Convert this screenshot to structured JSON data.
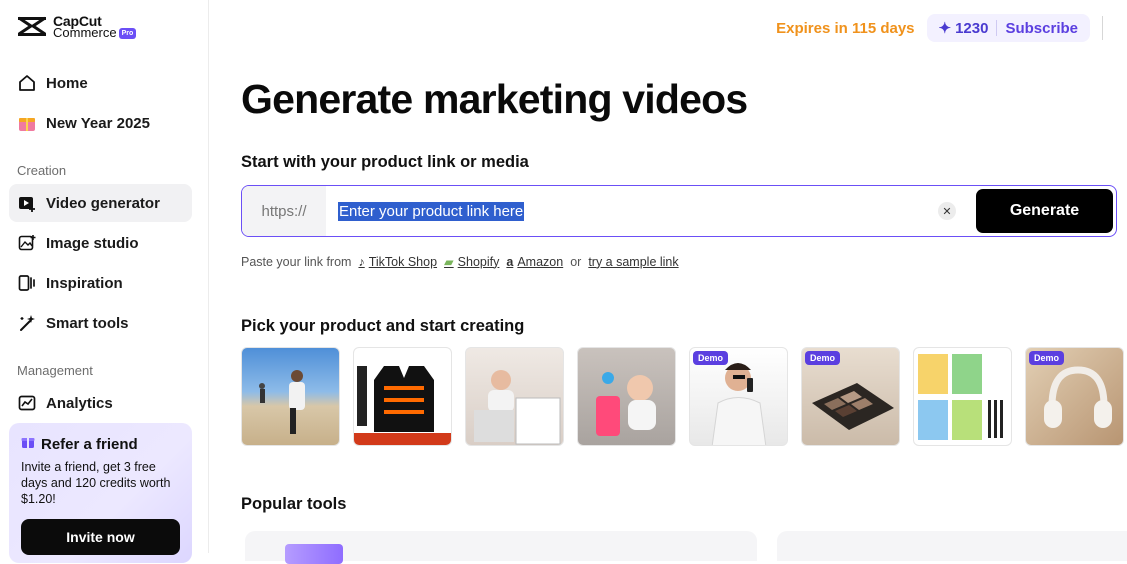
{
  "brand": {
    "name_line1": "CapCut",
    "name_line2": "Commerce",
    "badge": "Pro"
  },
  "sidebar": {
    "items": [
      {
        "label": "Home",
        "icon": "home-icon"
      },
      {
        "label": "New Year 2025",
        "icon": "gift-icon"
      }
    ],
    "creation_label": "Creation",
    "creation_items": [
      {
        "label": "Video generator",
        "icon": "video-plus-icon",
        "active": true
      },
      {
        "label": "Image studio",
        "icon": "image-plus-icon"
      },
      {
        "label": "Inspiration",
        "icon": "inspiration-icon"
      },
      {
        "label": "Smart tools",
        "icon": "magic-wand-icon"
      }
    ],
    "management_label": "Management",
    "management_items": [
      {
        "label": "Analytics",
        "icon": "chart-line-icon"
      }
    ],
    "refer": {
      "title": "Refer a friend",
      "description": "Invite a friend, get 3 free days and 120 credits worth $1.20!",
      "button": "Invite now"
    }
  },
  "topbar": {
    "expires": "Expires in 115 days",
    "credits": "1230",
    "subscribe": "Subscribe"
  },
  "main": {
    "title": "Generate marketing videos",
    "start_label": "Start with your product link or media",
    "link_prefix": "https://",
    "link_value": "Enter your product link here",
    "generate": "Generate",
    "paste": {
      "lead": "Paste your link from",
      "sources": [
        "TikTok Shop",
        "Shopify",
        "Amazon"
      ],
      "or": "or",
      "sample": "try a sample link"
    },
    "pick_label": "Pick your product and start creating",
    "demo_badge": "Demo",
    "popular_label": "Popular tools"
  },
  "colors": {
    "accent": "#6b4ff6",
    "expires": "#f0921c",
    "selection": "#2f5fce"
  }
}
